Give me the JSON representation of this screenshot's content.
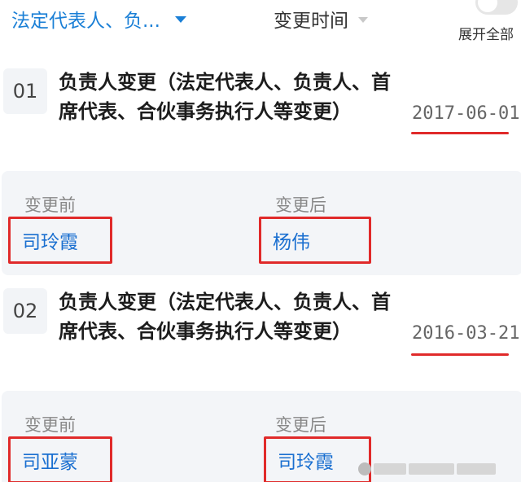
{
  "header": {
    "filter_type_label": "法定代表人、负...",
    "filter_time_label": "变更时间",
    "expand_all_label": "展开全部",
    "caret_icon": "caret-down-icon",
    "toggle_on": false
  },
  "records": [
    {
      "index": "01",
      "title": "负责人变更（法定代表人、负责人、首席代表、合伙事务执行人等变更）",
      "date": "2017-06-01",
      "before_label": "变更前",
      "before_value": "司玲霞",
      "after_label": "变更后",
      "after_value": "杨伟"
    },
    {
      "index": "02",
      "title": "负责人变更（法定代表人、负责人、首席代表、合伙事务执行人等变更）",
      "date": "2016-03-21",
      "before_label": "变更前",
      "before_value": "司亚蒙",
      "after_label": "变更后",
      "after_value": "司玲霞"
    }
  ],
  "colors": {
    "accent": "#1a7fd6",
    "highlight": "#e02a2a",
    "panel": "#f3f5f8"
  }
}
